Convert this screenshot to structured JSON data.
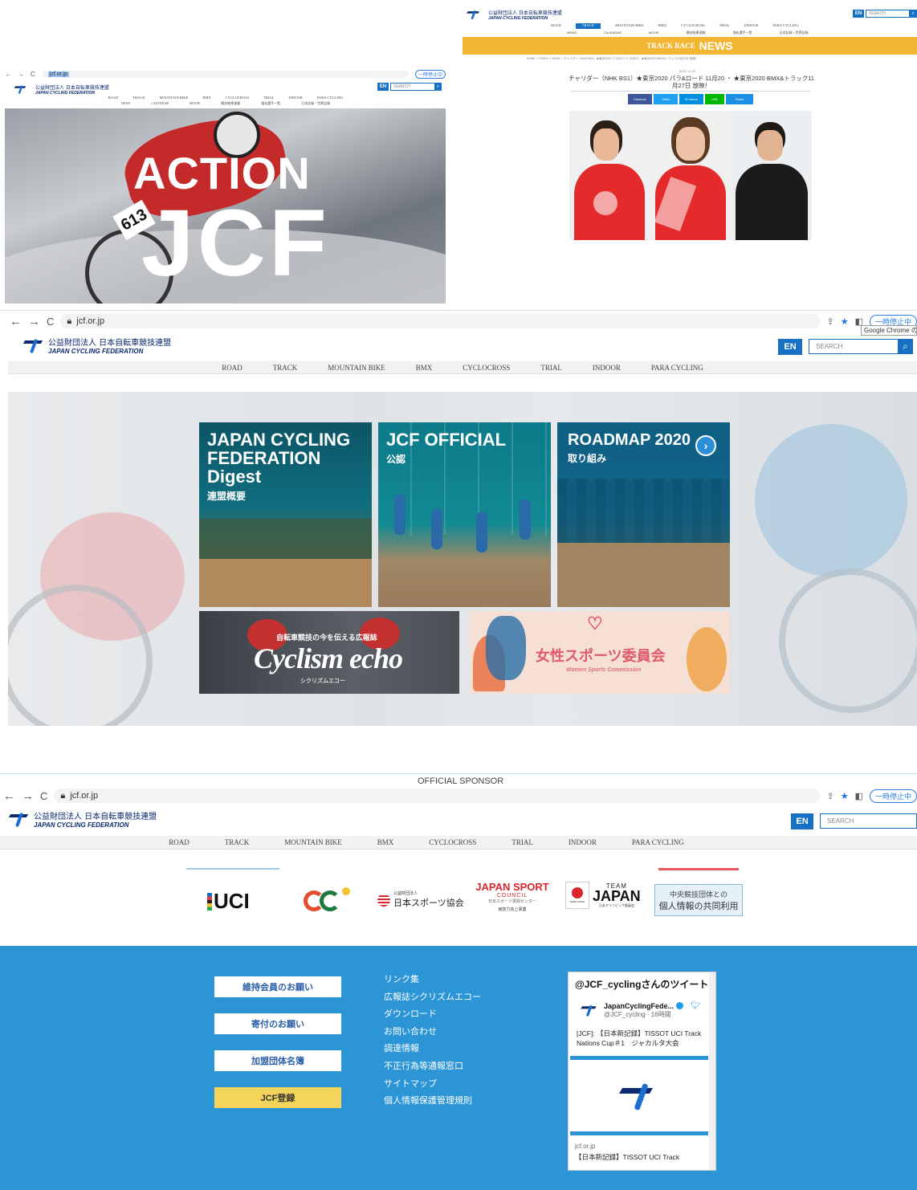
{
  "panel1": {
    "url": "jcf.or.jp",
    "pill": "一時停止中",
    "logo_jp": "公益財団法人 日本自転車競技連盟",
    "logo_en": "JAPAN CYCLING FEDERATION",
    "en": "EN",
    "search": "SEARCH",
    "nav": [
      "ROAD",
      "TRACK",
      "MOUNTAIN BIKE",
      "BMX",
      "CYCLOCROSS",
      "TRIAL",
      "INDOOR",
      "PARA CYCLING"
    ],
    "subnav": [
      "NEWS",
      "CALENDAR",
      "MOVIE",
      "競技結果速報",
      "強化選手一覧",
      "日本記録・世界記録"
    ],
    "hero_line1": "ACTION",
    "hero_line2": "JCF",
    "bib": "613"
  },
  "panel2": {
    "logo_jp": "公益財団法人 日本自転車競技連盟",
    "logo_en": "JAPAN CYCLING FEDERATION",
    "en": "EN",
    "search": "SEARCH",
    "nav": [
      "ROAD",
      "TRACK",
      "MOUNTAIN BIKE",
      "BMX",
      "CYCLOCROSS",
      "TRIAL",
      "INDOOR",
      "PARA CYCLING"
    ],
    "subnav": [
      "NEWS",
      "CALENDAR",
      "MOVIE",
      "競技結果速報",
      "強化選手一覧",
      "日本記録・世界記録"
    ],
    "banner_small": "TRACK RACE",
    "banner_big": "NEWS",
    "breadcrumb": "HOME > TRACK > NEWS > チャリダー（NHK BS1）★東京2020 パラ&ロード 11月20・★東京2020 BMX&トラック11月27日 放映！",
    "date": "2020.11.18",
    "title_l1": "チャリダー（NHK BS1）★東京2020 パラ&ロード 11月20 ・ ★東京2020 BMX&トラック11",
    "title_l2": "月27日 放映！",
    "share": [
      "Facebook",
      "Twitter",
      "B! Hatena",
      "LINE",
      "Pocket"
    ]
  },
  "panel3": {
    "url": "jcf.or.jp",
    "pill": "一時停止中",
    "tooltip": "Google Chrome の新",
    "logo_jp": "公益財団法人 日本自転車競技連盟",
    "logo_en": "JAPAN CYCLING FEDERATION",
    "en": "EN",
    "search": "SEARCH",
    "nav": [
      "ROAD",
      "TRACK",
      "MOUNTAIN BIKE",
      "BMX",
      "CYCLOCROSS",
      "TRIAL",
      "INDOOR",
      "PARA CYCLING"
    ],
    "tiles": {
      "digest_title": "JAPAN CYCLING FEDERATION Digest",
      "digest_sub": "連盟概要",
      "official_title": "JCF OFFICIAL",
      "official_sub": "公認",
      "roadmap_title": "ROADMAP 2020",
      "roadmap_sub": "取り組み",
      "echo_kicker": "自転車競技の今を伝える広報誌",
      "echo_title": "Cyclism echo",
      "echo_sub": "シクリズムエコー",
      "women_title": "女性スポーツ委員会",
      "women_sub": "Women Sports Commission"
    },
    "official_sponsor": "OFFICIAL SPONSOR"
  },
  "panel4": {
    "url": "jcf.or.jp",
    "pill": "一時停止中",
    "logo_jp": "公益財団法人 日本自転車競技連盟",
    "logo_en": "JAPAN CYCLING FEDERATION",
    "en": "EN",
    "search": "SEARCH",
    "nav": [
      "ROAD",
      "TRACK",
      "MOUNTAIN BIKE",
      "BMX",
      "CYCLOCROSS",
      "TRIAL",
      "INDOOR",
      "PARA CYCLING"
    ],
    "sponsors": {
      "uci": "UCI",
      "sport_assoc": "日本スポーツ協会",
      "sport_assoc_small": "公益財団法人",
      "jsc_title": "JAPAN SPORT",
      "jsc_council": "COUNCIL",
      "jsc_jp": "日本スポーツ振興センター",
      "jsc_foot": "競技力向上事業",
      "team_small": "TEAM",
      "team_big": "JAPAN",
      "team_jp": "日本オリンピック委員会",
      "team_badge": "TEAM JAPAN",
      "central_l1": "中央競技団体との",
      "central_l2": "個人情報の共同利用"
    },
    "footer_buttons": [
      "維持会員のお願い",
      "寄付のお願い",
      "加盟団体名簿",
      "JCF登録"
    ],
    "footer_links": [
      "リンク集",
      "広報誌シクリズムエコー",
      "ダウンロード",
      "お問い合わせ",
      "調達情報",
      "不正行為等通報窓口",
      "サイトマップ",
      "個人情報保護管理規則"
    ],
    "tweets": {
      "header": "@JCF_cyclingさんのツイート",
      "name": "JapanCyclingFede...",
      "handle": "@JCF_cycling · 16時間",
      "text_l1": "[JCF]: 【日本新記録】TISSOT UCI Track",
      "text_l2": "Nations Cup＃1　ジャカルタ大会",
      "card_url": "jcf.or.jp",
      "card_text": "【日本新記録】TISSOT UCI Track"
    }
  },
  "colors": {
    "brand_blue": "#1670c4",
    "footer_blue": "#2b95d6",
    "track_yellow": "#f2b632",
    "navy": "#0b2a6f"
  }
}
